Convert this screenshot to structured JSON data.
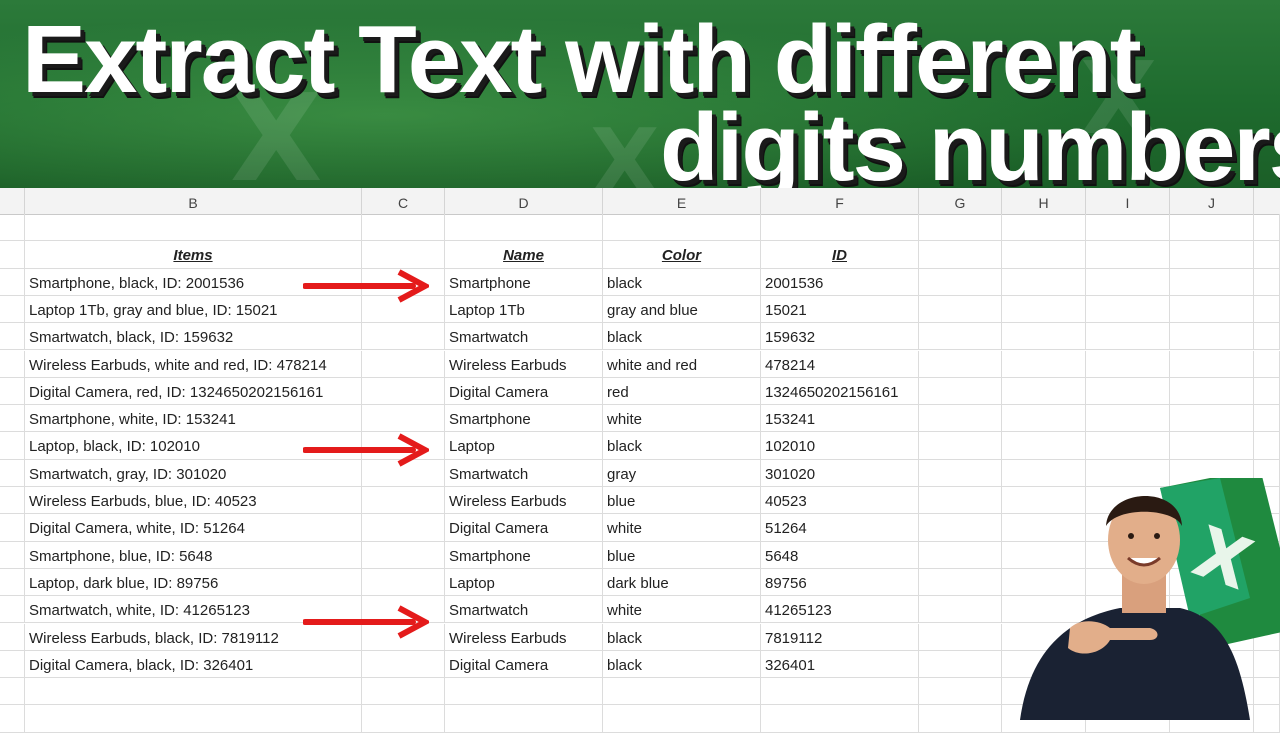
{
  "banner": {
    "title_line1": "Extract Text with different",
    "title_line2": "digits numbers"
  },
  "columns": [
    "B",
    "C",
    "D",
    "E",
    "F",
    "G",
    "H",
    "I",
    "J"
  ],
  "headers": {
    "items": "Items",
    "name": "Name",
    "color": "Color",
    "id": "ID"
  },
  "rows": [
    {
      "item": "Smartphone, black, ID: 2001536",
      "name": "Smartphone",
      "color": "black",
      "id": "2001536"
    },
    {
      "item": "Laptop 1Tb, gray and blue, ID: 15021",
      "name": "Laptop 1Tb",
      "color": "gray and blue",
      "id": "15021"
    },
    {
      "item": "Smartwatch, black, ID: 159632",
      "name": "Smartwatch",
      "color": "black",
      "id": "159632"
    },
    {
      "item": "Wireless Earbuds, white and red, ID: 478214",
      "name": "Wireless Earbuds",
      "color": "white and red",
      "id": "478214"
    },
    {
      "item": "Digital Camera, red, ID: 1324650202156161",
      "name": "Digital Camera",
      "color": "red",
      "id": "1324650202156161"
    },
    {
      "item": "Smartphone, white, ID: 153241",
      "name": "Smartphone",
      "color": "white",
      "id": "153241"
    },
    {
      "item": "Laptop, black, ID: 102010",
      "name": "Laptop",
      "color": "black",
      "id": "102010"
    },
    {
      "item": "Smartwatch, gray, ID: 301020",
      "name": "Smartwatch",
      "color": "gray",
      "id": "301020"
    },
    {
      "item": "Wireless Earbuds, blue, ID: 40523",
      "name": "Wireless Earbuds",
      "color": "blue",
      "id": "40523"
    },
    {
      "item": "Digital Camera, white, ID: 51264",
      "name": "Digital Camera",
      "color": "white",
      "id": "51264"
    },
    {
      "item": "Smartphone, blue, ID: 5648",
      "name": "Smartphone",
      "color": "blue",
      "id": "5648"
    },
    {
      "item": "Laptop, dark blue, ID: 89756",
      "name": "Laptop",
      "color": "dark blue",
      "id": "89756"
    },
    {
      "item": "Smartwatch, white, ID: 41265123",
      "name": "Smartwatch",
      "color": "white",
      "id": "41265123"
    },
    {
      "item": "Wireless Earbuds, black, ID: 7819112",
      "name": "Wireless Earbuds",
      "color": "black",
      "id": "7819112"
    },
    {
      "item": "Digital Camera, black, ID: 326401",
      "name": "Digital Camera",
      "color": "black",
      "id": "326401"
    }
  ],
  "colors": {
    "arrow": "#e41b1b",
    "banner": "#1e6b2e",
    "excel_green": "#1f8a3f"
  },
  "icons": [
    "right-arrow-icon",
    "excel-logo-icon"
  ]
}
